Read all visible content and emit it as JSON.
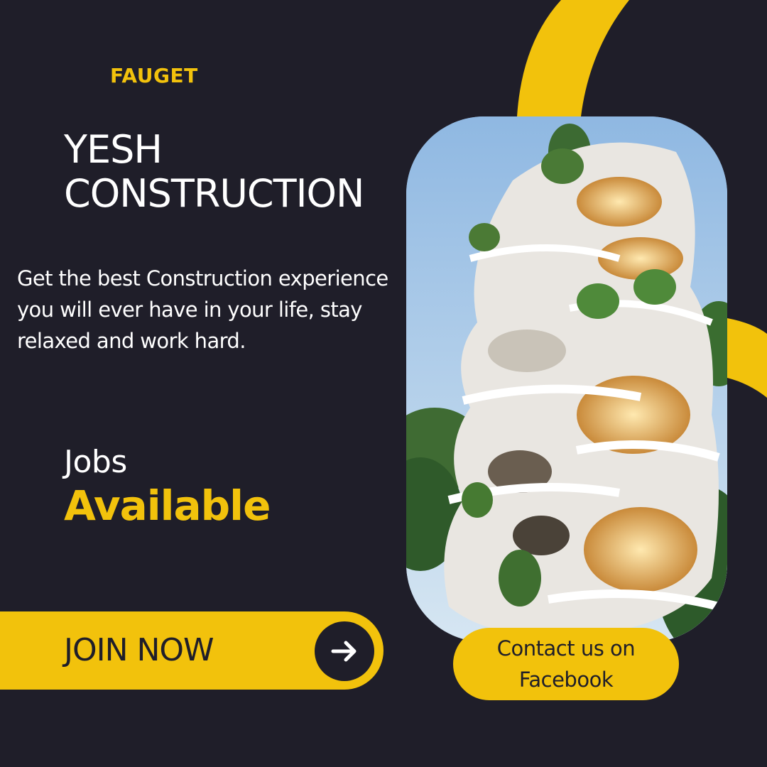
{
  "brand": "FAUGET",
  "title": {
    "line1": "YESH",
    "line2": "CONSTRUCTION"
  },
  "tagline": "Get the best Construction experience you will ever have in your life, stay relaxed and work hard.",
  "jobs": {
    "line1": "Jobs",
    "line2": "Available"
  },
  "join_button": {
    "label": "JOIN NOW",
    "icon": "arrow-right-icon"
  },
  "contact_button": {
    "line1": "Contact us on",
    "line2": "Facebook"
  },
  "colors": {
    "background": "#1f1e29",
    "accent": "#f2c20c",
    "text": "#ffffff"
  }
}
